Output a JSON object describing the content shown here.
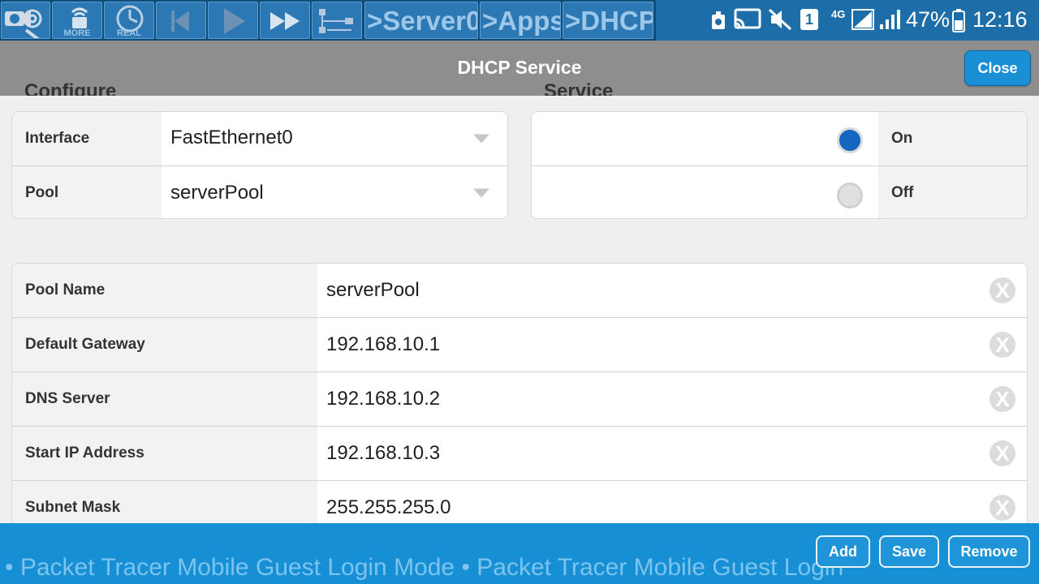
{
  "toolbar": {
    "more_caption": "MORE",
    "real_caption": "REAL",
    "breadcrumbs": [
      ">Server0",
      ">Apps",
      ">DHCP"
    ]
  },
  "statusbar": {
    "sim": "1",
    "network": "4G",
    "battery": "47%",
    "time": "12:16"
  },
  "header": {
    "title": "DHCP Service",
    "close_label": "Close"
  },
  "sections": {
    "configure": "Configure",
    "service": "Service"
  },
  "configure": {
    "interface_label": "Interface",
    "interface_value": "FastEthernet0",
    "pool_label": "Pool",
    "pool_value": "serverPool"
  },
  "service": {
    "on_label": "On",
    "off_label": "Off",
    "state": "on"
  },
  "fields": [
    {
      "label": "Pool Name",
      "value": "serverPool"
    },
    {
      "label": "Default Gateway",
      "value": "192.168.10.1"
    },
    {
      "label": "DNS Server",
      "value": "192.168.10.2"
    },
    {
      "label": "Start IP Address",
      "value": "192.168.10.3"
    },
    {
      "label": "Subnet Mask",
      "value": "255.255.255.0"
    }
  ],
  "clear_glyph": "X",
  "bottom": {
    "ticker": "• Packet Tracer Mobile Guest Login Mode • Packet Tracer Mobile Guest Login",
    "add_label": "Add",
    "save_label": "Save",
    "remove_label": "Remove"
  },
  "colors": {
    "accent": "#1a8fd6",
    "toolbar": "#0f4c7a",
    "header": "#8f8e8e",
    "radio_on": "#1566c0"
  }
}
